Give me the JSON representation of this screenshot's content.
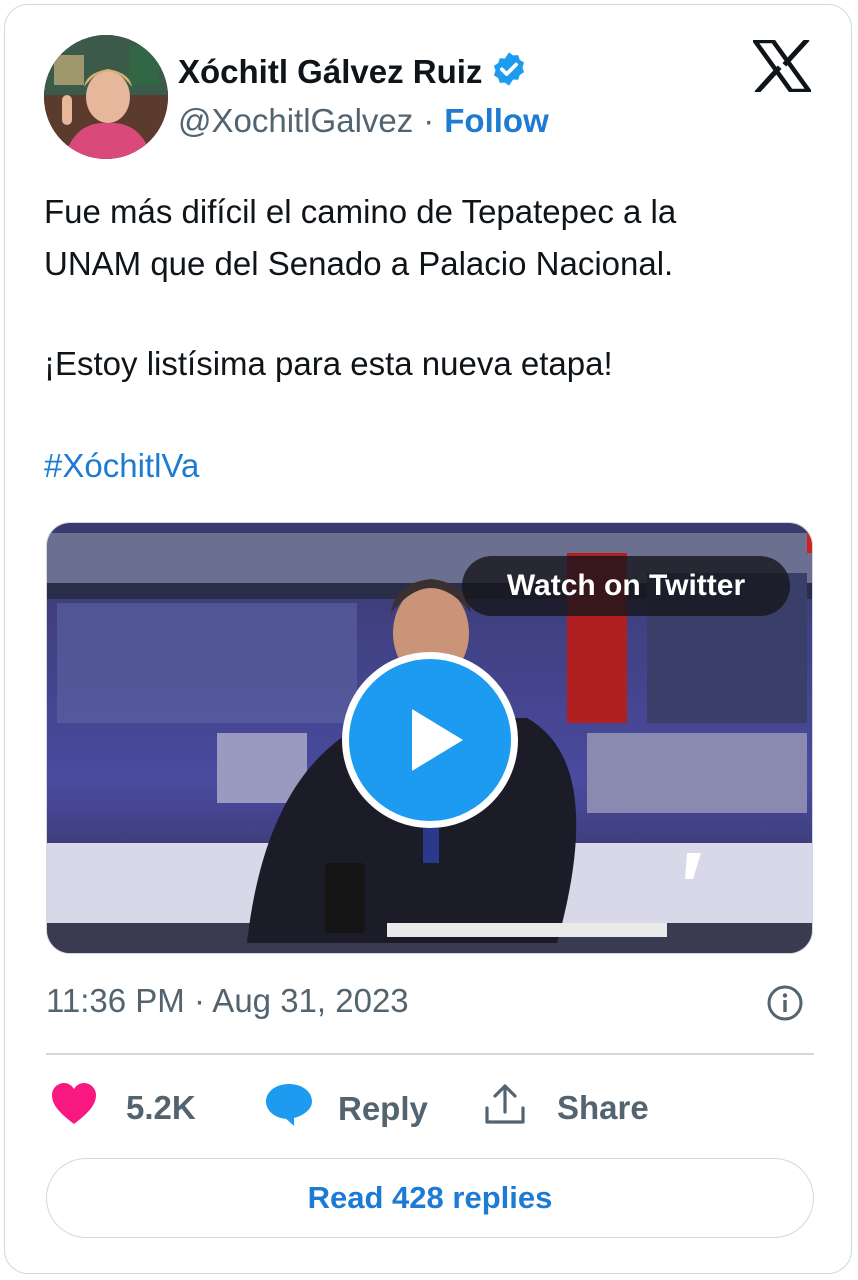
{
  "author": {
    "name": "Xóchitl Gálvez Ruiz",
    "handle": "@XochitlGalvez",
    "separator": "·",
    "follow_label": "Follow"
  },
  "tweet": {
    "lines": [
      "Fue más difícil el camino de Tepatepec a la",
      "UNAM que del Senado a Palacio Nacional.",
      "¡Estoy listísima para esta nueva etapa!"
    ],
    "hashtag": "#XóchitlVa"
  },
  "media": {
    "watch_label": "Watch on Twitter"
  },
  "timestamp": "11:36 PM · Aug 31, 2023",
  "actions": {
    "like_count": "5.2K",
    "reply_label": "Reply",
    "share_label": "Share"
  },
  "read_replies_label": "Read 428 replies",
  "colors": {
    "accent": "#1d9bf0",
    "link": "#1d7bd3",
    "like": "#f91880",
    "muted": "#536471"
  },
  "icons": [
    "verified-badge-icon",
    "x-logo-icon",
    "play-icon",
    "info-icon",
    "heart-icon",
    "reply-bubble-icon",
    "share-icon"
  ]
}
